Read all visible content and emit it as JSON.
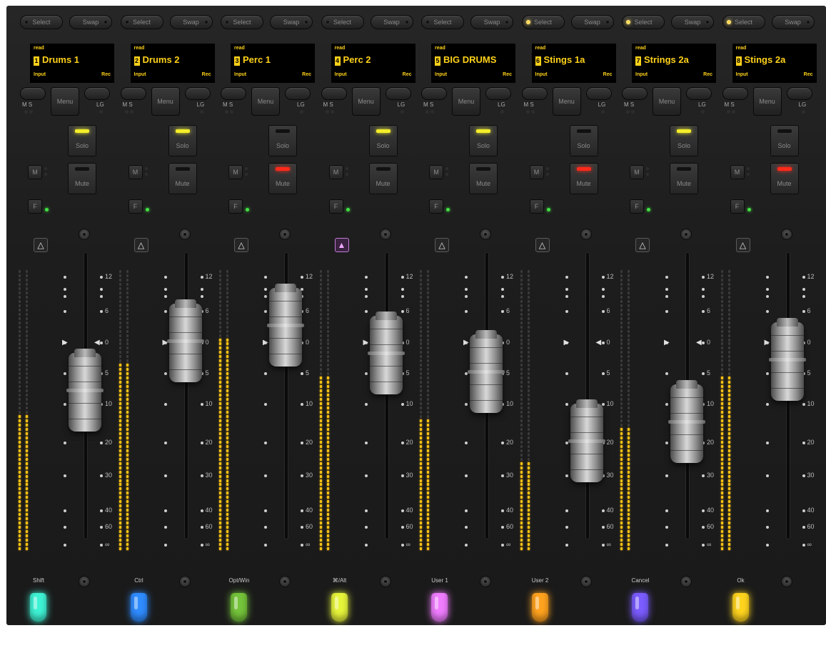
{
  "strips": [
    {
      "select": "Select",
      "swap": "Swap",
      "select_led": false,
      "mode": "read",
      "num": "1",
      "name": "Drums 1",
      "input": "Input",
      "rec": "Rec",
      "ms": "M S",
      "menu": "Menu",
      "lg": "LG",
      "solo": "Solo",
      "solo_on": true,
      "mute": "Mute",
      "mute_on": false,
      "m": "M",
      "f": "F",
      "f_on": true,
      "tri_active": false,
      "arrows": false,
      "meter_level": 0.48,
      "fader_db": -8,
      "fn_label": "Shift",
      "gem_color": "#3ef2d4"
    },
    {
      "select": "Select",
      "swap": "Swap",
      "select_led": false,
      "mode": "read",
      "num": "2",
      "name": "Drums 2",
      "input": "Input",
      "rec": "Rec",
      "ms": "M S",
      "menu": "Menu",
      "lg": "LG",
      "solo": "Solo",
      "solo_on": true,
      "mute": "Mute",
      "mute_on": false,
      "m": "M",
      "f": "F",
      "f_on": true,
      "tri_active": false,
      "arrows": false,
      "meter_level": 0.66,
      "fader_db": 0,
      "fn_label": "Ctrl",
      "gem_color": "#2f8cff"
    },
    {
      "select": "Select",
      "swap": "Swap",
      "select_led": false,
      "mode": "read",
      "num": "3",
      "name": "Perc 1",
      "input": "Input",
      "rec": "Rec",
      "ms": "M S",
      "menu": "Menu",
      "lg": "LG",
      "solo": "Solo",
      "solo_on": false,
      "mute": "Mute",
      "mute_on": true,
      "m": "M",
      "f": "F",
      "f_on": true,
      "tri_active": false,
      "arrows": false,
      "meter_level": 0.75,
      "fader_db": 3,
      "fn_label": "Opt/Win",
      "gem_color": "#74c33a"
    },
    {
      "select": "Select",
      "swap": "Swap",
      "select_led": false,
      "mode": "read",
      "num": "4",
      "name": "Perc 2",
      "input": "Input",
      "rec": "Rec",
      "ms": "M S",
      "menu": "Menu",
      "lg": "LG",
      "solo": "Solo",
      "solo_on": true,
      "mute": "Mute",
      "mute_on": false,
      "m": "M",
      "f": "F",
      "f_on": true,
      "tri_active": true,
      "arrows": false,
      "meter_level": 0.62,
      "fader_db": -2,
      "fn_label": "⌘/Alt",
      "gem_color": "#e6f43a"
    },
    {
      "select": "Select",
      "swap": "Swap",
      "select_led": false,
      "mode": "read",
      "num": "5",
      "name": "BIG DRUMS",
      "input": "Input",
      "rec": "Rec",
      "ms": "M S",
      "menu": "Menu",
      "lg": "LG",
      "solo": "Solo",
      "solo_on": true,
      "mute": "Mute",
      "mute_on": false,
      "m": "M",
      "f": "F",
      "f_on": true,
      "tri_active": false,
      "arrows": false,
      "meter_level": 0.47,
      "fader_db": -5,
      "fn_label": "User 1",
      "gem_color": "#f07cff"
    },
    {
      "select": "Select",
      "swap": "Swap",
      "select_led": true,
      "mode": "read",
      "num": "6",
      "name": "Stings 1a",
      "input": "Input",
      "rec": "Rec",
      "ms": "M S",
      "menu": "Menu",
      "lg": "LG",
      "solo": "Solo",
      "solo_on": false,
      "mute": "Mute",
      "mute_on": true,
      "m": "M",
      "f": "F",
      "f_on": true,
      "tri_active": false,
      "arrows": true,
      "meter_level": 0.32,
      "fader_db": -20,
      "fn_label": "User 2",
      "gem_color": "#ffa21e"
    },
    {
      "select": "Select",
      "swap": "Swap",
      "select_led": true,
      "mode": "read",
      "num": "7",
      "name": "Strings 2a",
      "input": "Input",
      "rec": "Rec",
      "ms": "M S",
      "menu": "Menu",
      "lg": "LG",
      "solo": "Solo",
      "solo_on": true,
      "mute": "Mute",
      "mute_on": false,
      "m": "M",
      "f": "F",
      "f_on": true,
      "tri_active": false,
      "arrows": true,
      "meter_level": 0.44,
      "fader_db": -15,
      "fn_label": "Cancel",
      "gem_color": "#7a5cff"
    },
    {
      "select": "Select",
      "swap": "Swap",
      "select_led": true,
      "mode": "read",
      "num": "8",
      "name": "Stings 2a",
      "input": "Input",
      "rec": "Rec",
      "ms": "M S",
      "menu": "Menu",
      "lg": "LG",
      "solo": "Solo",
      "solo_on": false,
      "mute": "Mute",
      "mute_on": true,
      "m": "M",
      "f": "F",
      "f_on": true,
      "tri_active": false,
      "arrows": false,
      "meter_level": 0.62,
      "fader_db": -3,
      "fn_label": "Ok",
      "gem_color": "#ffd41e"
    }
  ],
  "scale_labels": [
    "12",
    "6",
    "0",
    "5",
    "10",
    "20",
    "30",
    "40",
    "60",
    "∞"
  ],
  "colors": {
    "solo_led": "#f4ee2a",
    "mute_led": "#ff2a1a",
    "meter_led": "#ffc414",
    "lcd_text": "#ffd21a"
  }
}
